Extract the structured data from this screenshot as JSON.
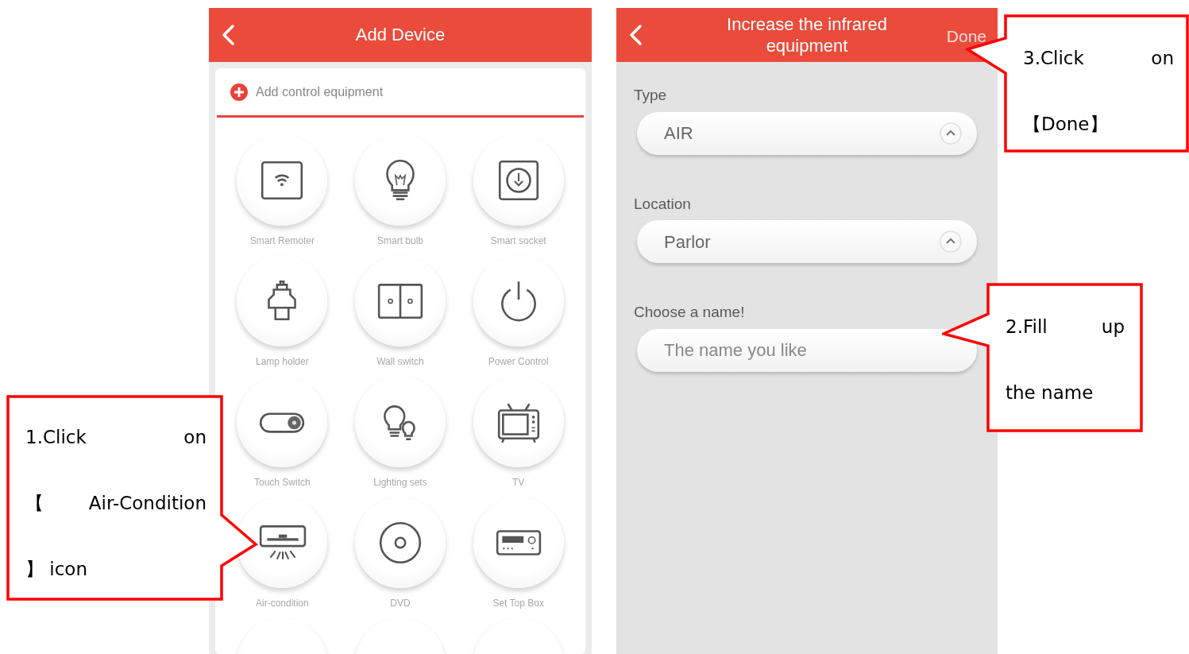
{
  "add_device_screen": {
    "title": "Add Device",
    "add_row": {
      "label": "Add control equipment"
    },
    "devices": [
      {
        "label": "Smart Remoter"
      },
      {
        "label": "Smart bulb"
      },
      {
        "label": "Smart socket"
      },
      {
        "label": "Lamp holder"
      },
      {
        "label": "Wall switch"
      },
      {
        "label": "Power Control"
      },
      {
        "label": "Touch Switch"
      },
      {
        "label": "Lighting sets"
      },
      {
        "label": "TV"
      },
      {
        "label": "Air-condition"
      },
      {
        "label": "DVD"
      },
      {
        "label": "Set Top Box"
      }
    ]
  },
  "infrared_screen": {
    "title": "Increase the infrared equipment",
    "action": "Done",
    "fields": [
      {
        "kind": "select",
        "label": "Type",
        "value": "AIR"
      },
      {
        "kind": "select",
        "label": "Location",
        "value": "Parlor"
      },
      {
        "kind": "input",
        "label": "Choose a name!",
        "placeholder": "The name you like"
      }
    ]
  },
  "callouts": [
    {
      "lines": [
        "1.Click on",
        "【 Air-Condition",
        "】 icon"
      ]
    },
    {
      "lines": [
        "3.Click on",
        "【Done】"
      ]
    },
    {
      "lines": [
        "2.Fill up",
        "the name"
      ]
    }
  ]
}
